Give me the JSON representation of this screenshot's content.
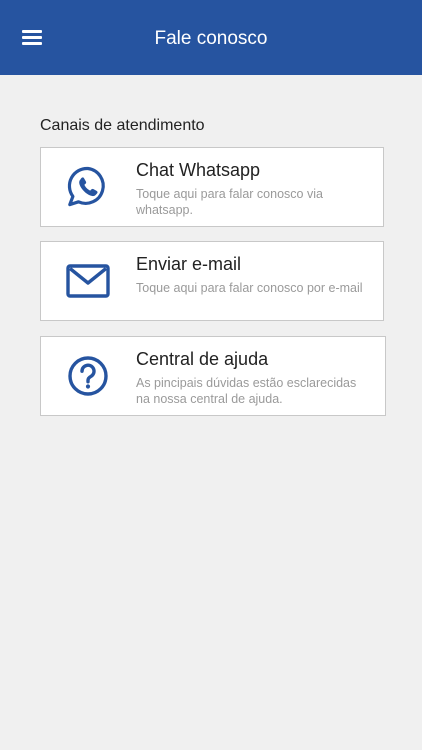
{
  "header": {
    "title": "Fale conosco",
    "menu_icon": "hamburger-menu-icon",
    "background": "#2654a0"
  },
  "section": {
    "label": "Canais de atendimento"
  },
  "channels": [
    {
      "title": "Chat Whatsapp",
      "description": "Toque aqui para falar conosco via whatsapp.",
      "icon": "whatsapp-icon"
    },
    {
      "title": "Enviar e-mail",
      "description": "Toque aqui para falar conosco por e-mail",
      "icon": "envelope-icon"
    },
    {
      "title": "Central de ajuda",
      "description": "As pincipais dúvidas estão esclarecidas na nossa central de ajuda.",
      "icon": "question-circle-icon"
    }
  ],
  "colors": {
    "accent": "#2654a0",
    "background": "#f0f0f0",
    "card_border": "#c8c8c8"
  }
}
